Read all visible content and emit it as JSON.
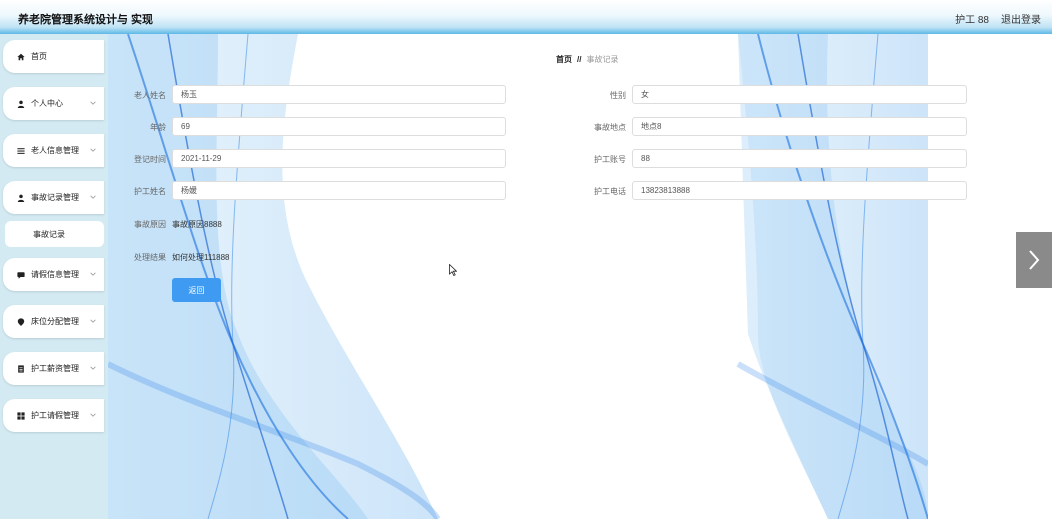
{
  "header": {
    "title": "养老院管理系统设计与 实现",
    "user_label": "护工 88",
    "logout_label": "退出登录"
  },
  "sidebar": {
    "items": [
      {
        "label": "首页",
        "icon": "home-icon"
      },
      {
        "label": "个人中心",
        "icon": "user-icon"
      },
      {
        "label": "老人信息管理",
        "icon": "list-icon"
      },
      {
        "label": "事故记录管理",
        "icon": "user-icon"
      },
      {
        "label": "请假信息管理",
        "icon": "message-icon"
      },
      {
        "label": "床位分配管理",
        "icon": "location-icon"
      },
      {
        "label": "护工薪资管理",
        "icon": "document-icon"
      },
      {
        "label": "护工请假管理",
        "icon": "grid-icon"
      }
    ],
    "sub_item": "事故记录"
  },
  "breadcrumb": {
    "home": "首页",
    "separator": "//",
    "current": "事故记录"
  },
  "form": {
    "elder_name": {
      "label": "老人姓名",
      "value": "杨玉"
    },
    "gender": {
      "label": "性别",
      "value": "女"
    },
    "age": {
      "label": "年龄",
      "value": "69"
    },
    "location": {
      "label": "事故地点",
      "value": "地点8"
    },
    "reg_time": {
      "label": "登记时间",
      "value": "2021-11-29"
    },
    "nurse_no": {
      "label": "护工账号",
      "value": "88"
    },
    "nurse_name": {
      "label": "护工姓名",
      "value": "杨媛"
    },
    "nurse_phone": {
      "label": "护工电话",
      "value": "13823813888"
    },
    "cause": {
      "label": "事故原因",
      "value": "事故原因8888"
    },
    "result": {
      "label": "处理结果",
      "value": "如何处理111888"
    },
    "back_label": "返回"
  },
  "colors": {
    "accent": "#3f9bf2",
    "sidebar_bg": "#d3eaf3",
    "header_bottom": "#5cb8e6"
  }
}
